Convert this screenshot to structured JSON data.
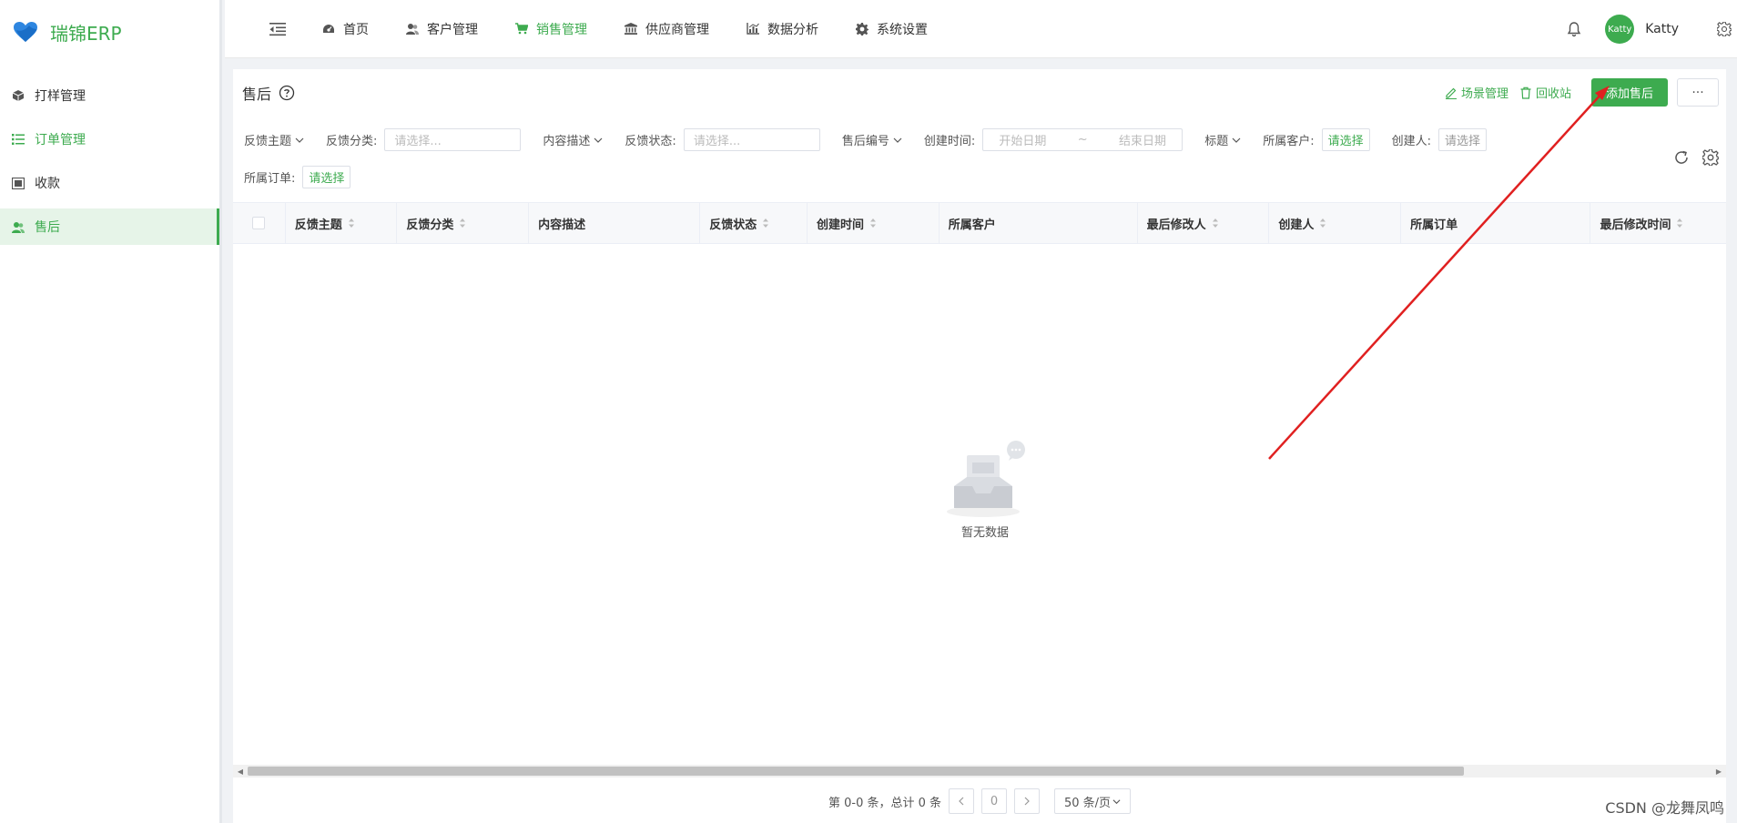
{
  "app": {
    "name": "瑞锦ERP",
    "logo_icon": "heart-logo-icon"
  },
  "sidebar": {
    "items": [
      {
        "label": "打样管理",
        "icon": "cube-icon",
        "state": "normal"
      },
      {
        "label": "订单管理",
        "icon": "list-icon",
        "state": "highlight"
      },
      {
        "label": "收款",
        "icon": "wallet-icon",
        "state": "normal"
      },
      {
        "label": "售后",
        "icon": "users-icon",
        "state": "active"
      }
    ]
  },
  "topnav": {
    "items": [
      {
        "label": "首页",
        "icon": "dashboard-icon"
      },
      {
        "label": "客户管理",
        "icon": "user-group-icon"
      },
      {
        "label": "销售管理",
        "icon": "cart-icon",
        "active": true
      },
      {
        "label": "供应商管理",
        "icon": "bank-icon"
      },
      {
        "label": "数据分析",
        "icon": "bar-chart-icon"
      },
      {
        "label": "系统设置",
        "icon": "gear-icon"
      }
    ],
    "user": {
      "avatar_text": "Katty",
      "name": "Katty"
    }
  },
  "page": {
    "title": "售后",
    "actions": {
      "scene": "场景管理",
      "recycle": "回收站",
      "add": "添加售后",
      "more": "···"
    }
  },
  "filters": {
    "topic": "反馈主题",
    "category_label": "反馈分类:",
    "category_placeholder": "请选择...",
    "content": "内容描述",
    "status_label": "反馈状态:",
    "status_placeholder": "请选择...",
    "number": "售后编号",
    "created_label": "创建时间:",
    "start_date": "开始日期",
    "range_sep": "~",
    "end_date": "结束日期",
    "title": "标题",
    "customer_label": "所属客户:",
    "customer_pick": "请选择",
    "creator_label": "创建人:",
    "creator_pick": "请选择",
    "order_label": "所属订单:",
    "order_pick": "请选择"
  },
  "table": {
    "columns": [
      {
        "label": "反馈主题",
        "sortable": true
      },
      {
        "label": "反馈分类",
        "sortable": true
      },
      {
        "label": "内容描述",
        "sortable": false
      },
      {
        "label": "反馈状态",
        "sortable": true
      },
      {
        "label": "创建时间",
        "sortable": true
      },
      {
        "label": "所属客户",
        "sortable": false
      },
      {
        "label": "最后修改人",
        "sortable": true
      },
      {
        "label": "创建人",
        "sortable": true
      },
      {
        "label": "所属订单",
        "sortable": false
      },
      {
        "label": "最后修改时间",
        "sortable": true
      }
    ],
    "rows": [],
    "empty_text": "暂无数据"
  },
  "pagination": {
    "summary": "第 0-0 条，总计 0 条",
    "current_page": "0",
    "page_size": "50 条/页"
  },
  "watermark": "CSDN @龙舞凤鸣",
  "colors": {
    "accent": "#3dab4f",
    "annotation_arrow": "#e02020"
  }
}
